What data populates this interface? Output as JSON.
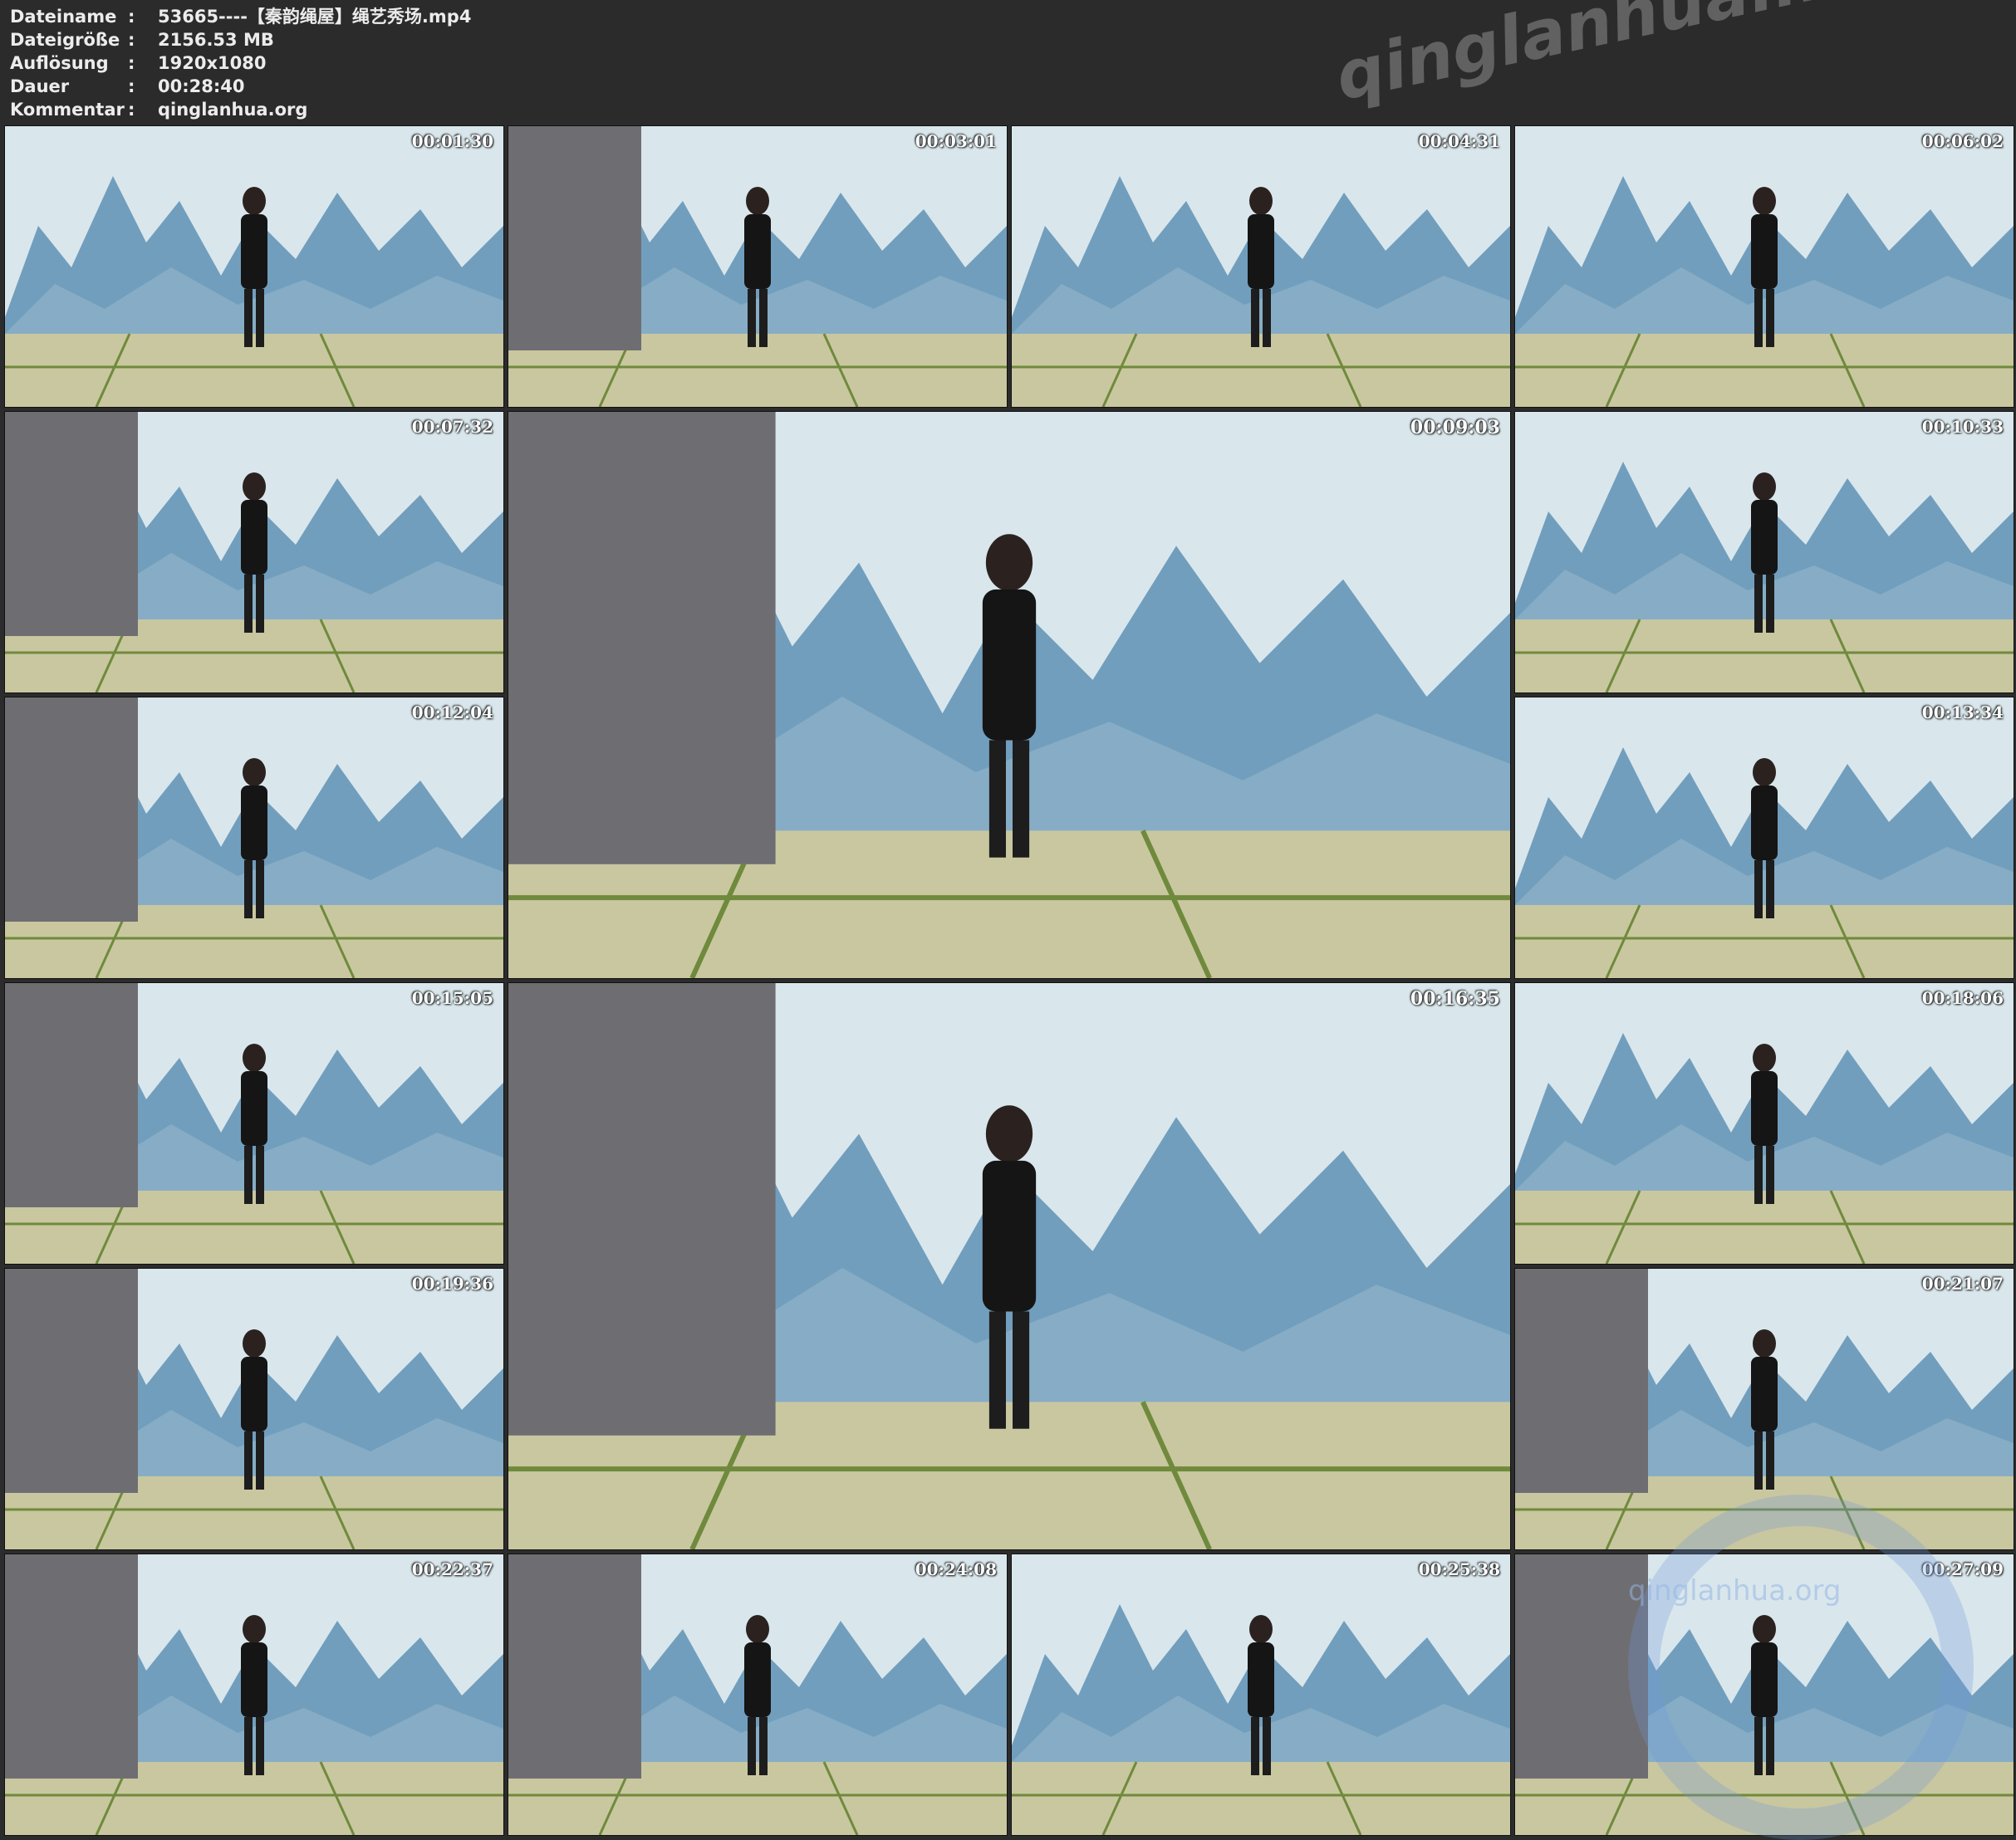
{
  "meta": [
    {
      "key": "Dateiname",
      "value": "53665----【秦韵绳屋】绳艺秀场.mp4"
    },
    {
      "key": "Dateigröße",
      "value": "2156.53 MB"
    },
    {
      "key": "Auflösung",
      "value": "1920x1080"
    },
    {
      "key": "Dauer",
      "value": "00:28:40"
    },
    {
      "key": "Kommentar",
      "value": "qinglanhua.org"
    }
  ],
  "separator": ":",
  "watermark_text": "qinglanhua.net",
  "watermark_text_2": "qinglanhua.org",
  "thumbnails": [
    {
      "timestamp": "00:01:30"
    },
    {
      "timestamp": "00:03:01"
    },
    {
      "timestamp": "00:04:31"
    },
    {
      "timestamp": "00:06:02"
    },
    {
      "timestamp": "00:07:32"
    },
    {
      "timestamp": "00:09:03"
    },
    {
      "timestamp": "00:10:33"
    },
    {
      "timestamp": "00:12:04"
    },
    {
      "timestamp": "00:13:34"
    },
    {
      "timestamp": "00:15:05"
    },
    {
      "timestamp": "00:16:35"
    },
    {
      "timestamp": "00:18:06"
    },
    {
      "timestamp": "00:19:36"
    },
    {
      "timestamp": "00:21:07"
    },
    {
      "timestamp": "00:22:37"
    },
    {
      "timestamp": "00:24:08"
    },
    {
      "timestamp": "00:25:38"
    },
    {
      "timestamp": "00:27:09"
    }
  ],
  "colors": {
    "background": "#2c2c2c",
    "wall": "#d9e7ec",
    "mountain": "#4f86ad",
    "floor": "#c9c7a0",
    "floor_line": "#6f8a3c",
    "curtain": "#6e6e72"
  }
}
